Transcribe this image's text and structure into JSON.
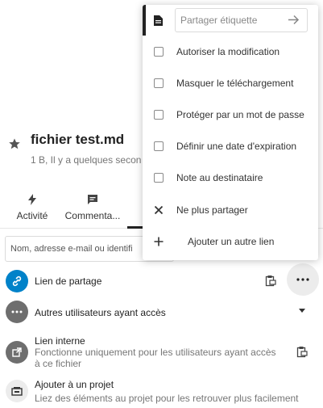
{
  "file": {
    "title": "fichier test.md",
    "subtitle": "1 B, Il y a quelques secon"
  },
  "tabs": [
    {
      "label": "Activité",
      "icon": "lightning-icon"
    },
    {
      "label": "Commenta...",
      "icon": "comment-icon"
    }
  ],
  "share_input": {
    "placeholder": "Nom, adresse e-mail ou identifi"
  },
  "share_rows": {
    "share_link": {
      "label": "Lien de partage",
      "icon": "link-icon",
      "color": "#0082c9"
    },
    "others": {
      "label": "Autres utilisateurs ayant accès",
      "icon": "more-horizontal-icon"
    },
    "internal": {
      "label": "Lien interne",
      "desc": "Fonctionne uniquement pour les utilisateurs ayant accès à ce fichier",
      "icon": "external-link-icon"
    },
    "project": {
      "label": "Ajouter à un projet",
      "desc": "Liez des éléments au projet pour les retrouver plus facilement",
      "icon": "projects-icon"
    }
  },
  "popover": {
    "label_placeholder": "Partager étiquette",
    "options": [
      "Autoriser la modification",
      "Masquer le téléchargement",
      "Protéger par un mot de passe",
      "Définir une date d'expiration",
      "Note au destinataire"
    ],
    "unshare": "Ne plus partager",
    "add_link": "Ajouter un autre lien"
  },
  "colors": {
    "primary": "#0082c9",
    "text": "#222222",
    "muted": "#767676"
  }
}
